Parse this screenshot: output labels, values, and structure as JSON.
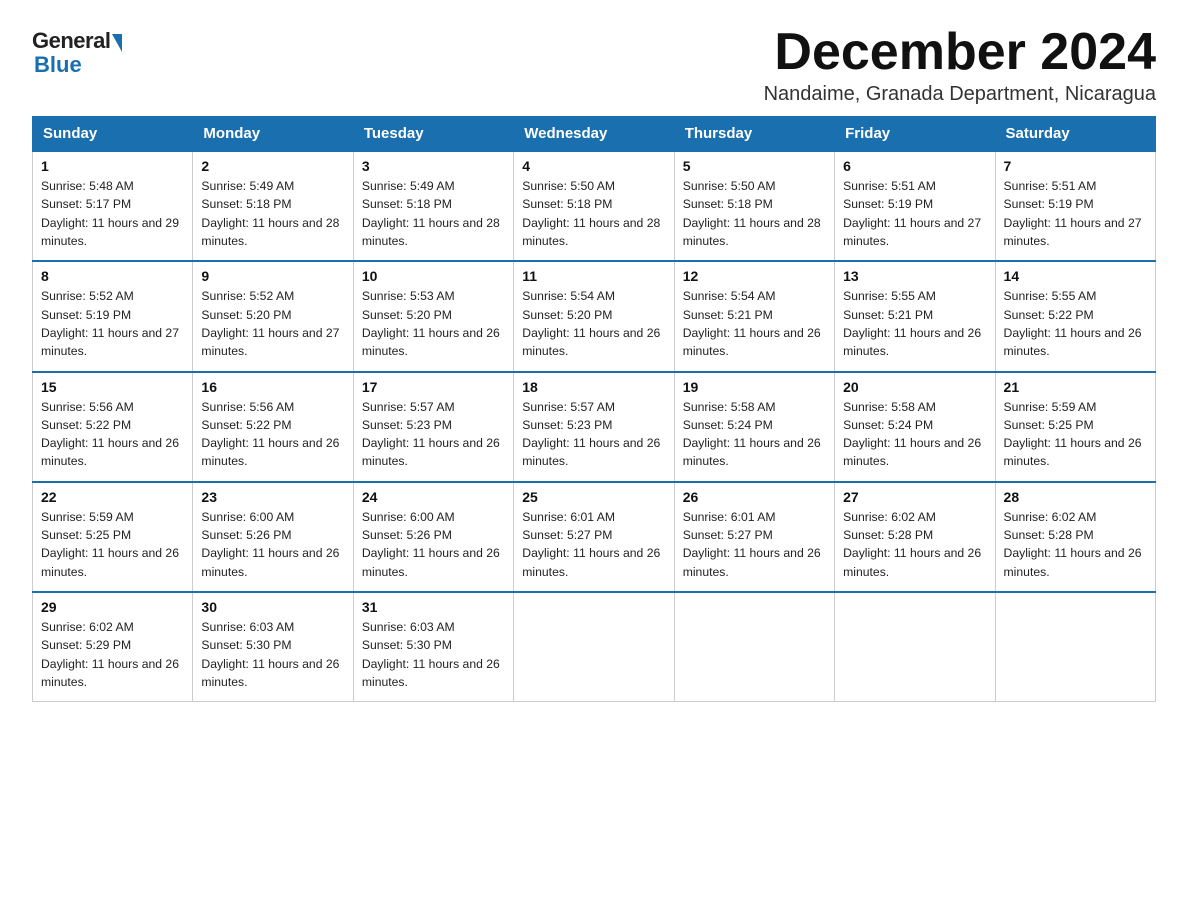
{
  "logo": {
    "general": "General",
    "blue": "Blue"
  },
  "title": "December 2024",
  "subtitle": "Nandaime, Granada Department, Nicaragua",
  "days_of_week": [
    "Sunday",
    "Monday",
    "Tuesday",
    "Wednesday",
    "Thursday",
    "Friday",
    "Saturday"
  ],
  "weeks": [
    [
      {
        "day": "1",
        "sunrise": "5:48 AM",
        "sunset": "5:17 PM",
        "daylight": "11 hours and 29 minutes."
      },
      {
        "day": "2",
        "sunrise": "5:49 AM",
        "sunset": "5:18 PM",
        "daylight": "11 hours and 28 minutes."
      },
      {
        "day": "3",
        "sunrise": "5:49 AM",
        "sunset": "5:18 PM",
        "daylight": "11 hours and 28 minutes."
      },
      {
        "day": "4",
        "sunrise": "5:50 AM",
        "sunset": "5:18 PM",
        "daylight": "11 hours and 28 minutes."
      },
      {
        "day": "5",
        "sunrise": "5:50 AM",
        "sunset": "5:18 PM",
        "daylight": "11 hours and 28 minutes."
      },
      {
        "day": "6",
        "sunrise": "5:51 AM",
        "sunset": "5:19 PM",
        "daylight": "11 hours and 27 minutes."
      },
      {
        "day": "7",
        "sunrise": "5:51 AM",
        "sunset": "5:19 PM",
        "daylight": "11 hours and 27 minutes."
      }
    ],
    [
      {
        "day": "8",
        "sunrise": "5:52 AM",
        "sunset": "5:19 PM",
        "daylight": "11 hours and 27 minutes."
      },
      {
        "day": "9",
        "sunrise": "5:52 AM",
        "sunset": "5:20 PM",
        "daylight": "11 hours and 27 minutes."
      },
      {
        "day": "10",
        "sunrise": "5:53 AM",
        "sunset": "5:20 PM",
        "daylight": "11 hours and 26 minutes."
      },
      {
        "day": "11",
        "sunrise": "5:54 AM",
        "sunset": "5:20 PM",
        "daylight": "11 hours and 26 minutes."
      },
      {
        "day": "12",
        "sunrise": "5:54 AM",
        "sunset": "5:21 PM",
        "daylight": "11 hours and 26 minutes."
      },
      {
        "day": "13",
        "sunrise": "5:55 AM",
        "sunset": "5:21 PM",
        "daylight": "11 hours and 26 minutes."
      },
      {
        "day": "14",
        "sunrise": "5:55 AM",
        "sunset": "5:22 PM",
        "daylight": "11 hours and 26 minutes."
      }
    ],
    [
      {
        "day": "15",
        "sunrise": "5:56 AM",
        "sunset": "5:22 PM",
        "daylight": "11 hours and 26 minutes."
      },
      {
        "day": "16",
        "sunrise": "5:56 AM",
        "sunset": "5:22 PM",
        "daylight": "11 hours and 26 minutes."
      },
      {
        "day": "17",
        "sunrise": "5:57 AM",
        "sunset": "5:23 PM",
        "daylight": "11 hours and 26 minutes."
      },
      {
        "day": "18",
        "sunrise": "5:57 AM",
        "sunset": "5:23 PM",
        "daylight": "11 hours and 26 minutes."
      },
      {
        "day": "19",
        "sunrise": "5:58 AM",
        "sunset": "5:24 PM",
        "daylight": "11 hours and 26 minutes."
      },
      {
        "day": "20",
        "sunrise": "5:58 AM",
        "sunset": "5:24 PM",
        "daylight": "11 hours and 26 minutes."
      },
      {
        "day": "21",
        "sunrise": "5:59 AM",
        "sunset": "5:25 PM",
        "daylight": "11 hours and 26 minutes."
      }
    ],
    [
      {
        "day": "22",
        "sunrise": "5:59 AM",
        "sunset": "5:25 PM",
        "daylight": "11 hours and 26 minutes."
      },
      {
        "day": "23",
        "sunrise": "6:00 AM",
        "sunset": "5:26 PM",
        "daylight": "11 hours and 26 minutes."
      },
      {
        "day": "24",
        "sunrise": "6:00 AM",
        "sunset": "5:26 PM",
        "daylight": "11 hours and 26 minutes."
      },
      {
        "day": "25",
        "sunrise": "6:01 AM",
        "sunset": "5:27 PM",
        "daylight": "11 hours and 26 minutes."
      },
      {
        "day": "26",
        "sunrise": "6:01 AM",
        "sunset": "5:27 PM",
        "daylight": "11 hours and 26 minutes."
      },
      {
        "day": "27",
        "sunrise": "6:02 AM",
        "sunset": "5:28 PM",
        "daylight": "11 hours and 26 minutes."
      },
      {
        "day": "28",
        "sunrise": "6:02 AM",
        "sunset": "5:28 PM",
        "daylight": "11 hours and 26 minutes."
      }
    ],
    [
      {
        "day": "29",
        "sunrise": "6:02 AM",
        "sunset": "5:29 PM",
        "daylight": "11 hours and 26 minutes."
      },
      {
        "day": "30",
        "sunrise": "6:03 AM",
        "sunset": "5:30 PM",
        "daylight": "11 hours and 26 minutes."
      },
      {
        "day": "31",
        "sunrise": "6:03 AM",
        "sunset": "5:30 PM",
        "daylight": "11 hours and 26 minutes."
      },
      null,
      null,
      null,
      null
    ]
  ]
}
